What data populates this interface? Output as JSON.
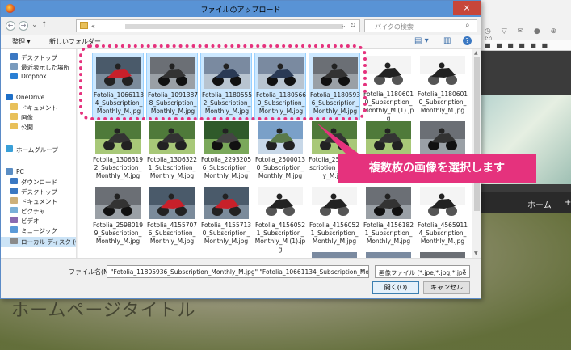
{
  "dialog": {
    "title": "ファイルのアップロード",
    "close_glyph": "×",
    "nav": {
      "back": "←",
      "forward": "→",
      "down": "⌄",
      "up": "↑"
    },
    "address": {
      "path_prefix": "«",
      "dropdown": "⌄",
      "refresh": "↻"
    },
    "search": {
      "placeholder": "バイクの検索",
      "icon": "search-icon"
    },
    "toolbar": {
      "organize": "整理 ▾",
      "new_folder": "新しいフォルダー",
      "view_icon": "view-icon",
      "pane_icon": "pane-icon",
      "help_icon": "help-icon",
      "view_glyph": "▤ ▾",
      "pane_glyph": "▥",
      "help_glyph": "?"
    },
    "left_nav": [
      {
        "label": "デスクトップ",
        "icon": "desktop-icon",
        "color": "#3b78c2"
      },
      {
        "label": "最近表示した場所",
        "icon": "recent-icon",
        "color": "#7a9bbd"
      },
      {
        "label": "Dropbox",
        "icon": "dropbox-icon",
        "color": "#2a7fd4"
      },
      {
        "label": "OneDrive",
        "icon": "onedrive-icon",
        "color": "#1e6fc8"
      },
      {
        "label": "ドキュメント",
        "icon": "folder-icon",
        "color": "#e8c05a"
      },
      {
        "label": "画像",
        "icon": "folder-icon",
        "color": "#e8c05a"
      },
      {
        "label": "公開",
        "icon": "folder-icon",
        "color": "#e8c05a"
      },
      {
        "label": "ホームグループ",
        "icon": "homegroup-icon",
        "color": "#3aa0d8"
      },
      {
        "label": "PC",
        "icon": "pc-icon",
        "color": "#5a8dc4"
      },
      {
        "label": "ダウンロード",
        "icon": "download-icon",
        "color": "#3b78c2"
      },
      {
        "label": "デスクトップ",
        "icon": "desktop-icon",
        "color": "#3b78c2"
      },
      {
        "label": "ドキュメント",
        "icon": "documents-icon",
        "color": "#cdb07a"
      },
      {
        "label": "ピクチャ",
        "icon": "pictures-icon",
        "color": "#7ab0d8"
      },
      {
        "label": "ビデオ",
        "icon": "videos-icon",
        "color": "#8a6ab0"
      },
      {
        "label": "ミュージック",
        "icon": "music-icon",
        "color": "#5a9ad8"
      },
      {
        "label": "ローカル ディスク (C",
        "icon": "disk-icon",
        "color": "#8a8a8a"
      }
    ],
    "files": [
      {
        "name": "Fotolia_10661134_Subscription_Monthly_M.jpg",
        "selected": true,
        "scene": "red"
      },
      {
        "name": "Fotolia_10913878_Subscription_Monthly_M.jpg",
        "selected": true,
        "scene": "road"
      },
      {
        "name": "Fotolia_11805552_Subscription_Monthly_M.jpg",
        "selected": true,
        "scene": "blue"
      },
      {
        "name": "Fotolia_11805660_Subscription_Monthly_M.jpg",
        "selected": true,
        "scene": "blue"
      },
      {
        "name": "Fotolia_11805936_Subscription_Monthly_M.jpg",
        "selected": true,
        "scene": "road"
      },
      {
        "name": "Fotolia_11806010_Subscription_Monthly_M (1).jpg",
        "selected": false,
        "scene": "white"
      },
      {
        "name": "Fotolia_11806010_Subscription_Monthly_M.jpg",
        "selected": false,
        "scene": "white"
      },
      {
        "name": "Fotolia_13063192_Subscription_Monthly_M.jpg",
        "selected": false,
        "scene": "green"
      },
      {
        "name": "Fotolia_13063221_Subscription_Monthly_M.jpg",
        "selected": false,
        "scene": "green"
      },
      {
        "name": "Fotolia_22932056_Subscription_Monthly_M.jpg",
        "selected": false,
        "scene": "tunnel"
      },
      {
        "name": "Fotolia_25000130_Subscription_Monthly_M.jpg",
        "selected": false,
        "scene": "mountain"
      },
      {
        "name": "Fotolia_25…_Subscription_Monthly_M.jpg",
        "selected": false,
        "scene": "green"
      },
      {
        "name": "",
        "selected": false,
        "scene": "green"
      },
      {
        "name": "",
        "selected": false,
        "scene": "road"
      },
      {
        "name": "Fotolia_25980199_Subscription_Monthly_M.jpg",
        "selected": false,
        "scene": "road"
      },
      {
        "name": "Fotolia_41557076_Subscription_Monthly_M.jpg",
        "selected": false,
        "scene": "red"
      },
      {
        "name": "Fotolia_41557130_Subscription_Monthly_M.jpg",
        "selected": false,
        "scene": "red"
      },
      {
        "name": "Fotolia_41560521_Subscription_Monthly_M (1).jpg",
        "selected": false,
        "scene": "white"
      },
      {
        "name": "Fotolia_41560521_Subscription_Monthly_M.jpg",
        "selected": false,
        "scene": "white"
      },
      {
        "name": "Fotolia_41561821_Subscription_Monthly_M.jpg",
        "selected": false,
        "scene": "road"
      },
      {
        "name": "Fotolia_45659114_Subscription_Monthly_M.jpg",
        "selected": false,
        "scene": "white"
      },
      {
        "name": "",
        "selected": false,
        "scene": "none"
      },
      {
        "name": "",
        "selected": false,
        "scene": "none"
      },
      {
        "name": "",
        "selected": false,
        "scene": "none"
      },
      {
        "name": "",
        "selected": false,
        "scene": "none"
      },
      {
        "name": "",
        "selected": false,
        "scene": "blue"
      },
      {
        "name": "",
        "selected": false,
        "scene": "blue"
      },
      {
        "name": "",
        "selected": false,
        "scene": "road"
      }
    ],
    "bottom": {
      "filename_label": "ファイル名(N):",
      "filename_value": "\"Fotolia_11805936_Subscription_Monthly_M.jpg\" \"Fotolia_10661134_Subscription_Mon",
      "filter_value": "画像ファイル (*.jpe;*.jpg;*.jpe",
      "open_label": "開く(O)",
      "cancel_label": "キャンセル",
      "dropdown": "▾"
    }
  },
  "annotation": {
    "callout_text": "複数枚の画像を選択します",
    "color": "#e5327d"
  },
  "background_page": {
    "nav_home": "ホーム",
    "nav_plus": "+",
    "title": "ホームページタイトル"
  }
}
